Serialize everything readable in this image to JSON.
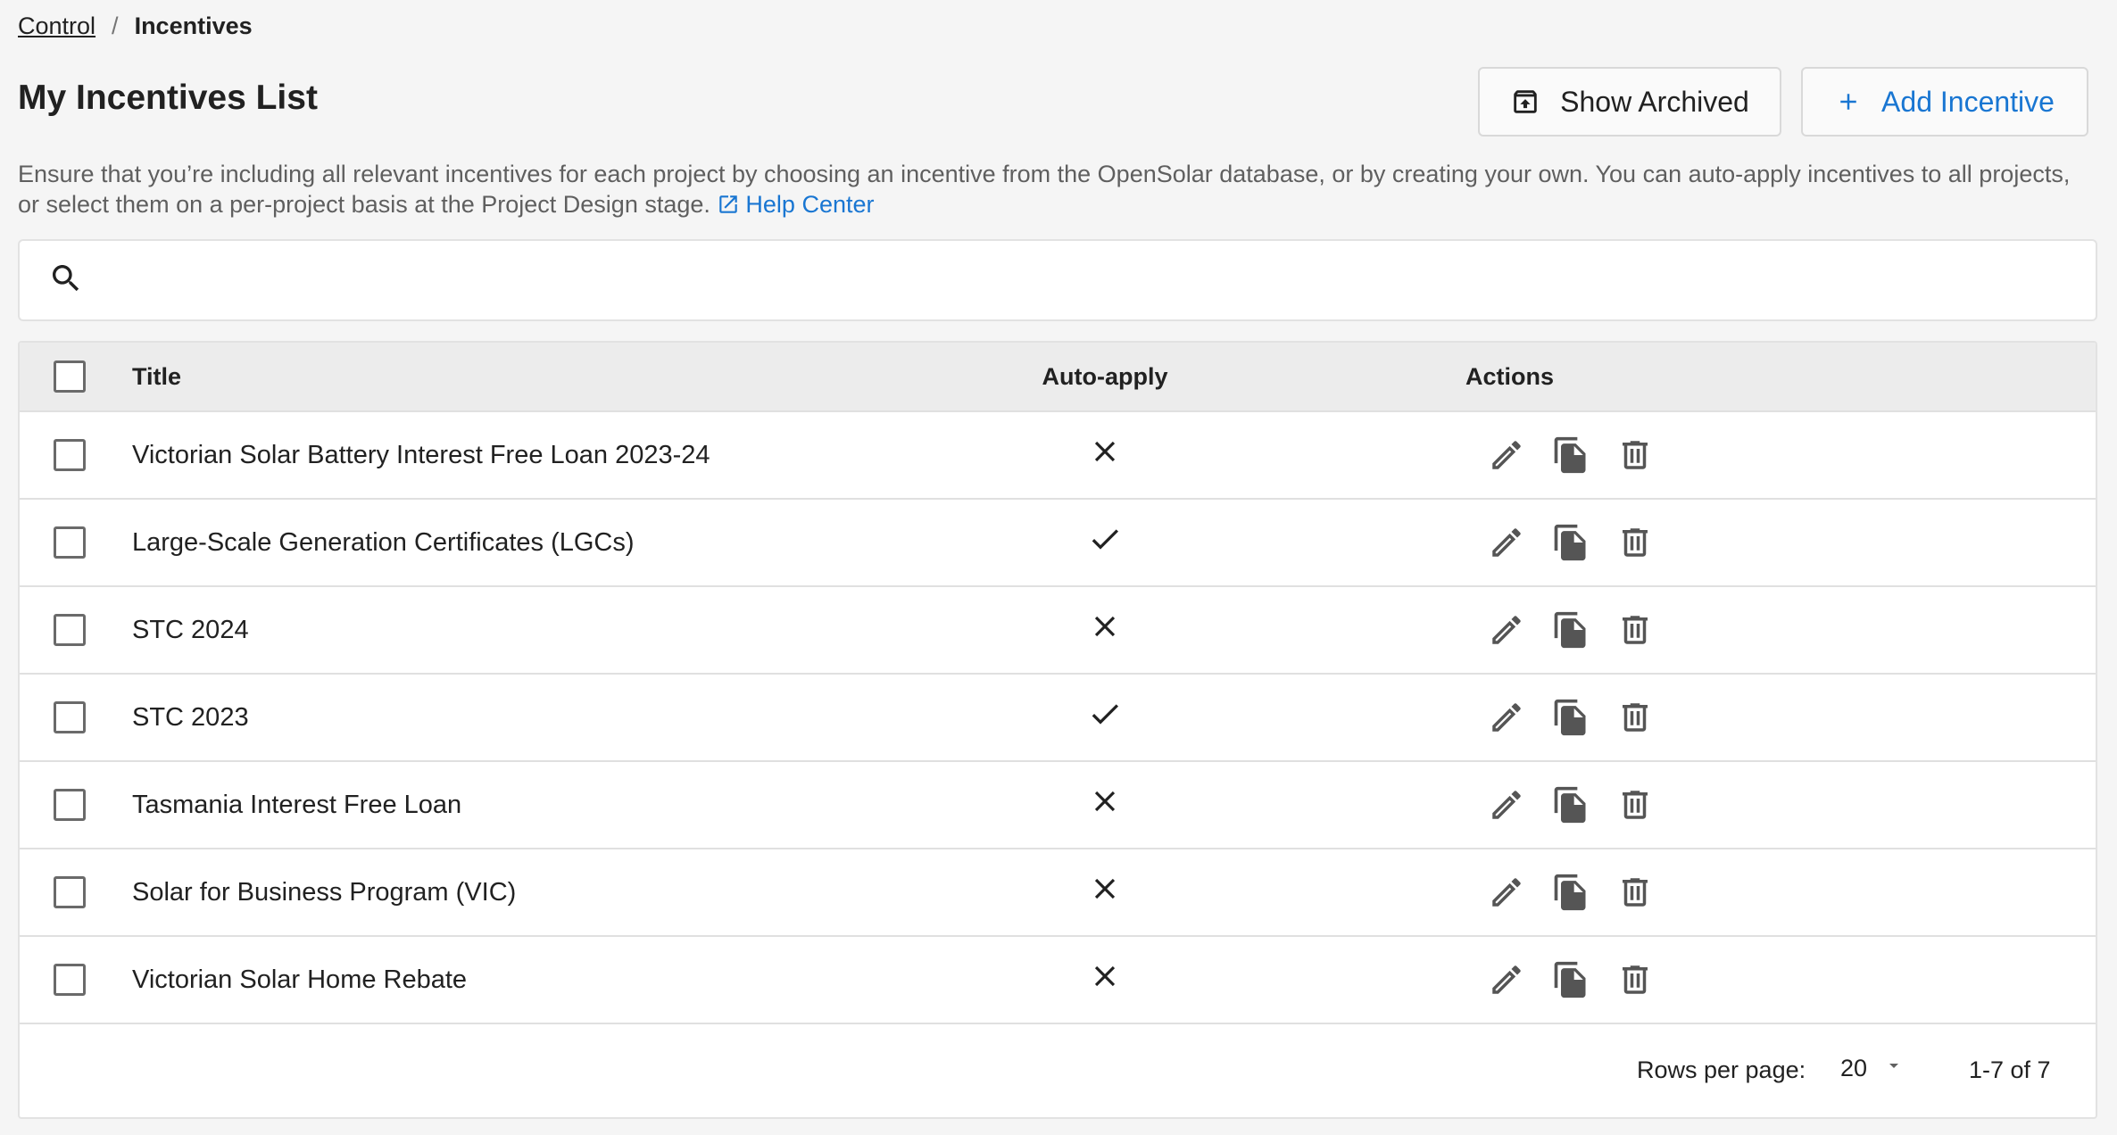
{
  "breadcrumb": {
    "parent": "Control",
    "separator": "/",
    "current": "Incentives"
  },
  "page_title": "My Incentives List",
  "buttons": {
    "show_archived": "Show Archived",
    "add_incentive": "Add Incentive"
  },
  "description": {
    "text": "Ensure that you’re including all relevant incentives for each project by choosing an incentive from the OpenSolar database, or by creating your own. You can auto-apply incentives to all projects, or select them on a per-project basis at the Project Design stage.",
    "help_link": "Help Center"
  },
  "search": {
    "value": ""
  },
  "table": {
    "headers": {
      "title": "Title",
      "auto_apply": "Auto-apply",
      "actions": "Actions"
    },
    "rows": [
      {
        "title": "Victorian Solar Battery Interest Free Loan 2023-24",
        "auto_apply": false
      },
      {
        "title": "Large-Scale Generation Certificates (LGCs)",
        "auto_apply": true
      },
      {
        "title": "STC 2024",
        "auto_apply": false
      },
      {
        "title": "STC 2023",
        "auto_apply": true
      },
      {
        "title": "Tasmania Interest Free Loan",
        "auto_apply": false
      },
      {
        "title": "Solar for Business Program (VIC)",
        "auto_apply": false
      },
      {
        "title": "Victorian Solar Home Rebate",
        "auto_apply": false
      }
    ]
  },
  "pagination": {
    "rows_per_page_label": "Rows per page:",
    "rows_per_page": "20",
    "range": "1-7 of 7"
  },
  "colors": {
    "accent": "#1976d2",
    "header_bg": "#ececec",
    "page_bg": "#f5f5f5"
  }
}
